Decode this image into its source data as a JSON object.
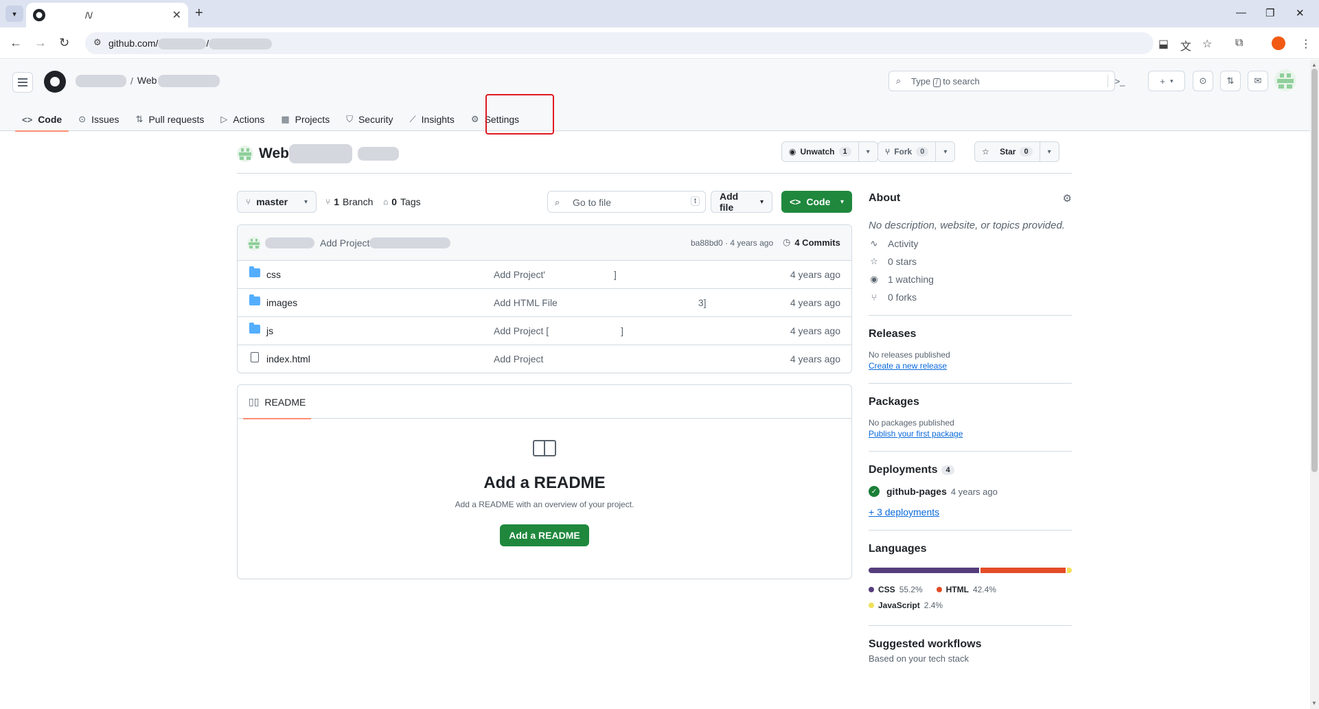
{
  "browser": {
    "tab_title": "/\\/",
    "url_prefix": "github.com/",
    "url_sep": "/"
  },
  "gh": {
    "owner_sep": "/",
    "repo_prefix": "Web",
    "search_pre": "Type",
    "search_kbd": "/",
    "search_post": "to search",
    "nav": [
      {
        "label": "Code",
        "icon": "code-icon"
      },
      {
        "label": "Issues",
        "icon": "issue-icon"
      },
      {
        "label": "Pull requests",
        "icon": "pull-request-icon"
      },
      {
        "label": "Actions",
        "icon": "play-icon"
      },
      {
        "label": "Projects",
        "icon": "table-icon"
      },
      {
        "label": "Security",
        "icon": "shield-icon"
      },
      {
        "label": "Insights",
        "icon": "graph-icon"
      },
      {
        "label": "Settings",
        "icon": "gear-icon"
      }
    ]
  },
  "repo": {
    "name_prefix": "Web",
    "unwatch_label": "Unwatch",
    "unwatch_count": "1",
    "fork_label": "Fork",
    "fork_count": "0",
    "star_label": "Star",
    "star_count": "0",
    "branch": "master",
    "branch_count": "1",
    "branch_word": "Branch",
    "tag_count": "0",
    "tag_word": "Tags",
    "goto_placeholder": "Go to file",
    "goto_kbd": "t",
    "add_file_label": "Add file",
    "code_label": "Code"
  },
  "commit": {
    "message": "Add Project",
    "sha": "ba88bd0",
    "sep": "·",
    "age": "4 years ago",
    "commits_label": "4 Commits"
  },
  "files": [
    {
      "name": "css",
      "type": "folder",
      "message": "Add Project'",
      "message_tail": "]",
      "date": "4 years ago"
    },
    {
      "name": "images",
      "type": "folder",
      "message": "Add HTML File",
      "message_tail": "3]",
      "date": "4 years ago"
    },
    {
      "name": "js",
      "type": "folder",
      "message": "Add Project [",
      "message_tail": "]",
      "date": "4 years ago"
    },
    {
      "name": "index.html",
      "type": "file",
      "message": "Add Project",
      "message_tail": "",
      "date": "4 years ago"
    }
  ],
  "readme": {
    "tab_label": "README",
    "title": "Add a README",
    "desc": "Add a README with an overview of your project.",
    "button": "Add a README"
  },
  "about": {
    "title": "About",
    "desc": "No description, website, or topics provided.",
    "stats": [
      {
        "label": "Activity",
        "icon": "pulse-icon"
      },
      {
        "label": "0 stars",
        "icon": "star-icon"
      },
      {
        "label": "1 watching",
        "icon": "eye-icon"
      },
      {
        "label": "0 forks",
        "icon": "fork-icon"
      }
    ]
  },
  "releases": {
    "title": "Releases",
    "none": "No releases published",
    "link": "Create a new release"
  },
  "packages": {
    "title": "Packages",
    "none": "No packages published",
    "link": "Publish your first package"
  },
  "deployments": {
    "title": "Deployments",
    "count": "4",
    "env": "github-pages",
    "age": "4 years ago",
    "more": "+ 3 deployments"
  },
  "languages": {
    "title": "Languages",
    "items": [
      {
        "name": "CSS",
        "pct": "55.2%",
        "value": 55.2,
        "color": "#563d7c"
      },
      {
        "name": "HTML",
        "pct": "42.4%",
        "value": 42.4,
        "color": "#e34c26"
      },
      {
        "name": "JavaScript",
        "pct": "2.4%",
        "value": 2.4,
        "color": "#f1e05a"
      }
    ]
  },
  "workflows": {
    "title": "Suggested workflows",
    "subtitle": "Based on your tech stack"
  }
}
